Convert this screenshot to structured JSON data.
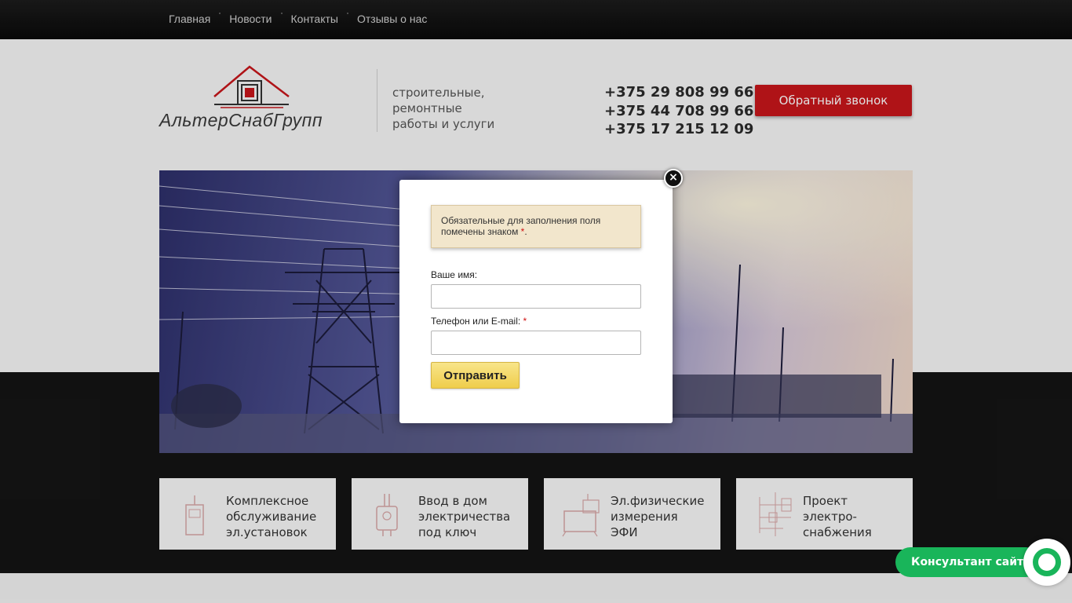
{
  "nav": {
    "items": [
      {
        "label": "Главная"
      },
      {
        "label": "Новости"
      },
      {
        "label": "Контакты"
      },
      {
        "label": "Отзывы о нас"
      }
    ]
  },
  "header": {
    "logo_text": "АльтерСнабГрупп",
    "slogan": [
      "строительные,",
      "ремонтные",
      "работы и услуги"
    ],
    "phones": [
      "+375 29 808 99 66",
      "+375 44 708 99 66",
      "+375 17 215 12 09"
    ],
    "callback_label": "Обратный звонок"
  },
  "services": [
    {
      "lines": [
        "Комплексное",
        "обслуживание",
        "эл.установок"
      ],
      "icon": "electrical-cabinet-icon"
    },
    {
      "lines": [
        "Ввод в дом",
        "электричества",
        "под ключ"
      ],
      "icon": "meter-box-icon"
    },
    {
      "lines": [
        "Эл.физические",
        "измерения",
        "ЭФИ"
      ],
      "icon": "measurement-device-icon"
    },
    {
      "lines": [
        "Проект",
        "электро-",
        "снабжения"
      ],
      "icon": "schematic-icon"
    }
  ],
  "modal": {
    "notice_text": "Обязательные для заполнения поля помечены знаком",
    "notice_star": "*",
    "notice_end": ".",
    "name_label": "Ваше имя:",
    "name_value": "",
    "contact_label": "Телефон или E-mail:",
    "contact_required": "*",
    "contact_value": "",
    "submit_label": "Отправить",
    "close_symbol": "×"
  },
  "consultant": {
    "label": "Консультант сайта"
  },
  "colors": {
    "accent_red": "#c8161b",
    "consult_green": "#19b55a",
    "submit_yellow": "#efcd4b"
  }
}
